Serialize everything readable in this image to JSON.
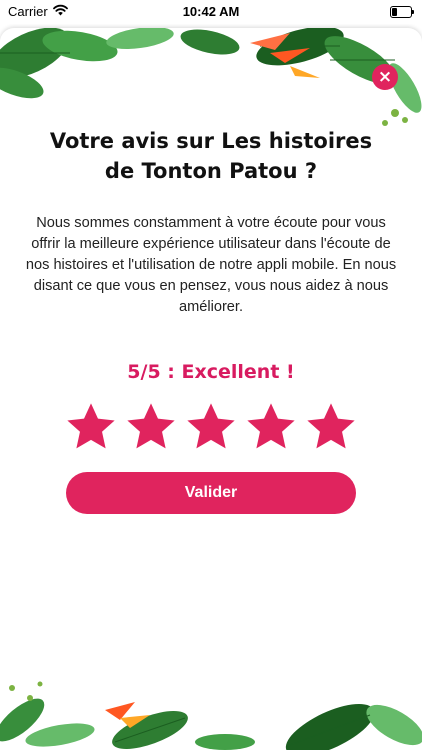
{
  "status_bar": {
    "carrier": "Carrier",
    "time": "10:42 AM"
  },
  "dialog": {
    "title": "Votre avis sur Les histoires de Tonton Patou ?",
    "description": "Nous sommes constamment à votre écoute pour vous offrir la meilleure expérience utilisateur dans l'écoute de nos histoires et l'utilisation de notre appli mobile. En nous disant ce que vous en pensez, vous nous aidez à nous améliorer.",
    "rating": {
      "value": 5,
      "max": 5,
      "label": "5/5 : Excellent !"
    },
    "submit_label": "Valider",
    "close_icon": "×"
  },
  "colors": {
    "accent": "#e0245e",
    "rating_text": "#d81b60",
    "star": "#e0245e"
  },
  "icons": [
    "wifi-icon",
    "battery-icon",
    "close-icon",
    "star-icon"
  ]
}
